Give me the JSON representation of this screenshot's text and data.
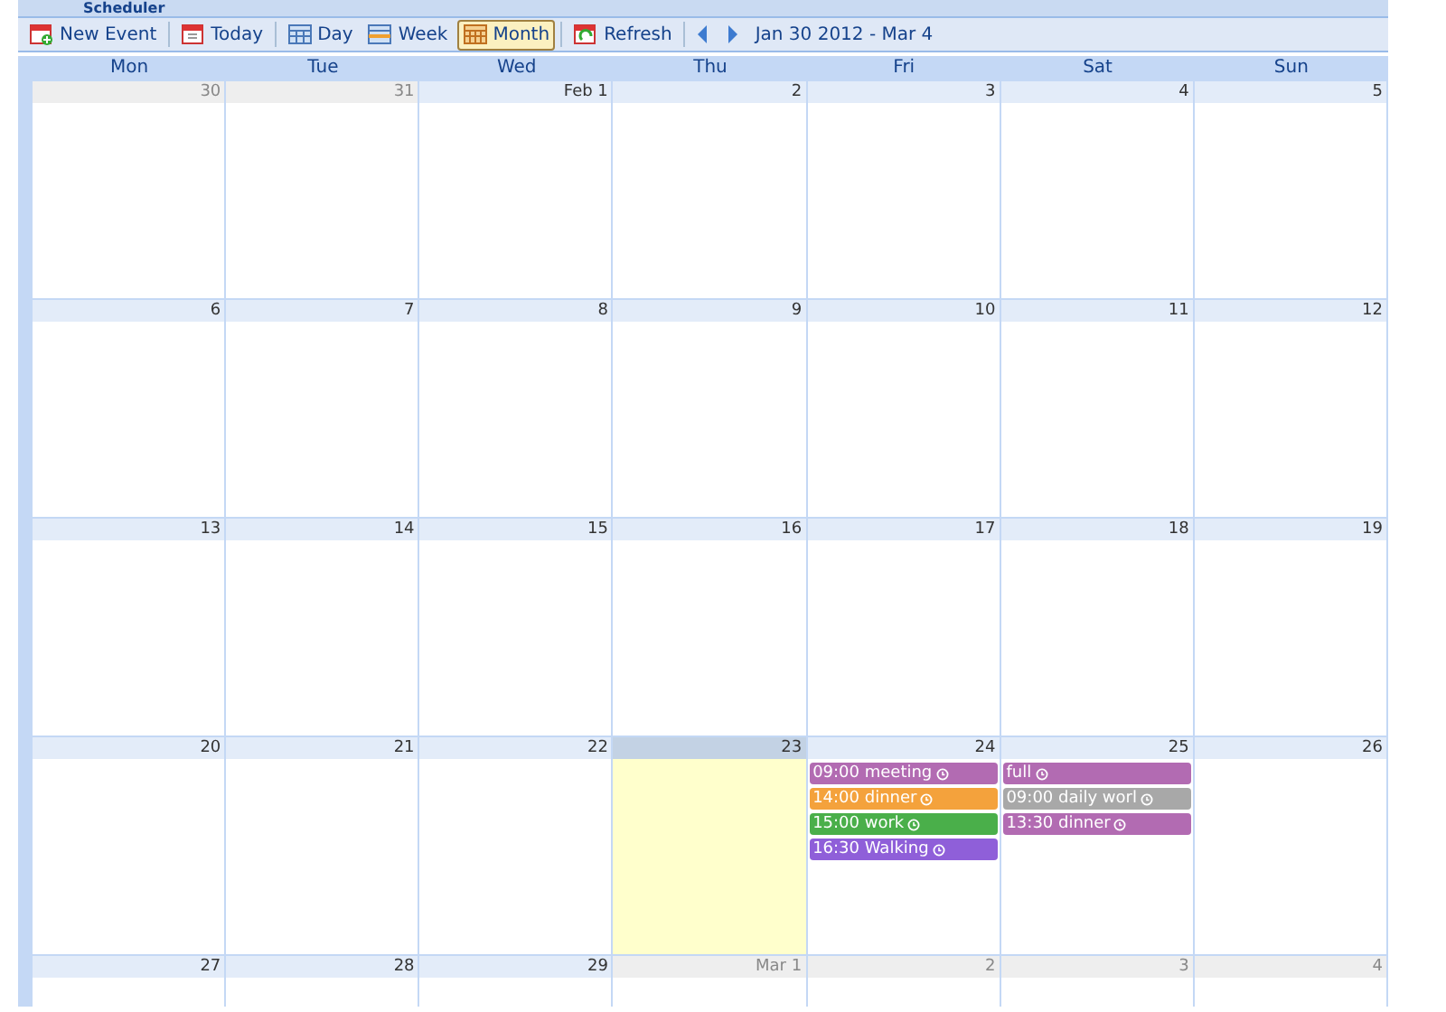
{
  "window": {
    "title": "Scheduler"
  },
  "toolbar": {
    "buttons": [
      {
        "label": "New Event",
        "kind": "new",
        "selected": false
      },
      {
        "label": "Today",
        "kind": "today",
        "selected": false
      },
      {
        "label": "Day",
        "kind": "day",
        "selected": false
      },
      {
        "label": "Week",
        "kind": "week",
        "selected": false
      },
      {
        "label": "Month",
        "kind": "month",
        "selected": true
      },
      {
        "label": "Refresh",
        "kind": "refresh",
        "selected": false
      }
    ],
    "range": "Jan 30 2012 - Mar 4"
  },
  "weekdays": [
    "Mon",
    "Tue",
    "Wed",
    "Thu",
    "Fri",
    "Sat",
    "Sun"
  ],
  "weeks": [
    [
      {
        "label": "30",
        "in_month": false,
        "today": false
      },
      {
        "label": "31",
        "in_month": false,
        "today": false
      },
      {
        "label": "Feb 1",
        "in_month": true,
        "today": false
      },
      {
        "label": "2",
        "in_month": true,
        "today": false
      },
      {
        "label": "3",
        "in_month": true,
        "today": false
      },
      {
        "label": "4",
        "in_month": true,
        "today": false
      },
      {
        "label": "5",
        "in_month": true,
        "today": false
      }
    ],
    [
      {
        "label": "6",
        "in_month": true,
        "today": false
      },
      {
        "label": "7",
        "in_month": true,
        "today": false
      },
      {
        "label": "8",
        "in_month": true,
        "today": false
      },
      {
        "label": "9",
        "in_month": true,
        "today": false
      },
      {
        "label": "10",
        "in_month": true,
        "today": false
      },
      {
        "label": "11",
        "in_month": true,
        "today": false
      },
      {
        "label": "12",
        "in_month": true,
        "today": false
      }
    ],
    [
      {
        "label": "13",
        "in_month": true,
        "today": false
      },
      {
        "label": "14",
        "in_month": true,
        "today": false
      },
      {
        "label": "15",
        "in_month": true,
        "today": false
      },
      {
        "label": "16",
        "in_month": true,
        "today": false
      },
      {
        "label": "17",
        "in_month": true,
        "today": false
      },
      {
        "label": "18",
        "in_month": true,
        "today": false
      },
      {
        "label": "19",
        "in_month": true,
        "today": false
      }
    ],
    [
      {
        "label": "20",
        "in_month": true,
        "today": false
      },
      {
        "label": "21",
        "in_month": true,
        "today": false
      },
      {
        "label": "22",
        "in_month": true,
        "today": false
      },
      {
        "label": "23",
        "in_month": true,
        "today": true
      },
      {
        "label": "24",
        "in_month": true,
        "today": false,
        "events": [
          {
            "text": "09:00 meeting",
            "color": "#b26bb2"
          },
          {
            "text": "14:00 dinner",
            "color": "#f4a23c"
          },
          {
            "text": "15:00 work",
            "color": "#4aaf4a"
          },
          {
            "text": "16:30 Walking",
            "color": "#8f5fd9"
          }
        ]
      },
      {
        "label": "25",
        "in_month": true,
        "today": false,
        "events": [
          {
            "text": "full",
            "color": "#b26bb2"
          },
          {
            "text": "09:00 daily worl",
            "color": "#a8a8a8"
          },
          {
            "text": "13:30 dinner",
            "color": "#b26bb2"
          }
        ]
      },
      {
        "label": "26",
        "in_month": true,
        "today": false
      }
    ],
    [
      {
        "label": "27",
        "in_month": true,
        "today": false
      },
      {
        "label": "28",
        "in_month": true,
        "today": false
      },
      {
        "label": "29",
        "in_month": true,
        "today": false
      },
      {
        "label": "Mar 1",
        "in_month": false,
        "today": false
      },
      {
        "label": "2",
        "in_month": false,
        "today": false
      },
      {
        "label": "3",
        "in_month": false,
        "today": false
      },
      {
        "label": "4",
        "in_month": false,
        "today": false
      }
    ]
  ]
}
